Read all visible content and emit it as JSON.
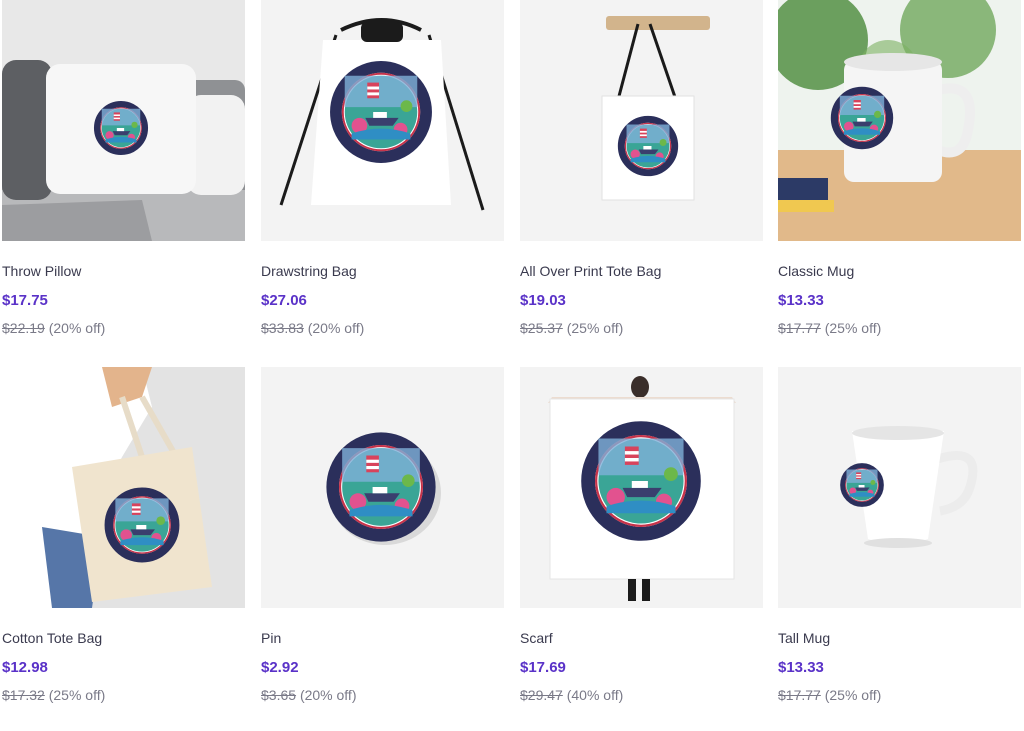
{
  "colors": {
    "price": "#5a32c8",
    "title": "#3a3a4e",
    "muted": "#7a7a88",
    "badge_navy": "#2b2f5b",
    "badge_red": "#c7334a"
  },
  "badge": {
    "top": "PRIDE OF AMERICA",
    "bottom": "HAWAII CRUISE"
  },
  "products": [
    {
      "title": "Throw Pillow",
      "price": "$17.75",
      "original_price": "$22.19",
      "discount": "(20% off)",
      "image": "throw-pillow-image"
    },
    {
      "title": "Drawstring Bag",
      "price": "$27.06",
      "original_price": "$33.83",
      "discount": "(20% off)",
      "image": "drawstring-bag-image"
    },
    {
      "title": "All Over Print Tote Bag",
      "price": "$19.03",
      "original_price": "$25.37",
      "discount": "(25% off)",
      "image": "tote-bag-image"
    },
    {
      "title": "Classic Mug",
      "price": "$13.33",
      "original_price": "$17.77",
      "discount": "(25% off)",
      "image": "classic-mug-image"
    },
    {
      "title": "Cotton Tote Bag",
      "price": "$12.98",
      "original_price": "$17.32",
      "discount": "(25% off)",
      "image": "cotton-tote-image"
    },
    {
      "title": "Pin",
      "price": "$2.92",
      "original_price": "$3.65",
      "discount": "(20% off)",
      "image": "pin-image"
    },
    {
      "title": "Scarf",
      "price": "$17.69",
      "original_price": "$29.47",
      "discount": "(40% off)",
      "image": "scarf-image"
    },
    {
      "title": "Tall Mug",
      "price": "$13.33",
      "original_price": "$17.77",
      "discount": "(25% off)",
      "image": "tall-mug-image"
    }
  ]
}
